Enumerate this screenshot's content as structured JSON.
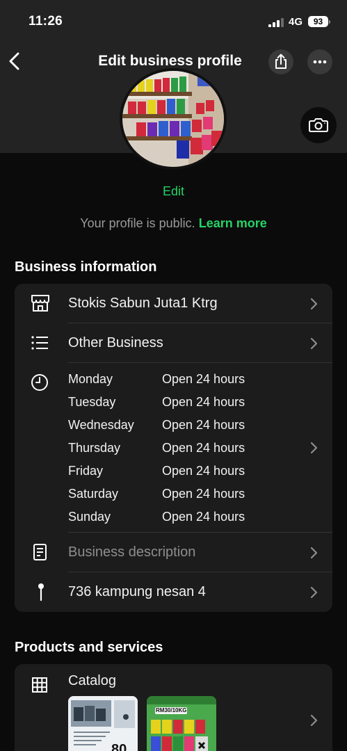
{
  "status_bar": {
    "time": "11:26",
    "network": "4G",
    "battery": "93"
  },
  "nav": {
    "title": "Edit business profile"
  },
  "profile": {
    "edit_label": "Edit",
    "public_text": "Your profile is public.",
    "learn_more": "Learn more"
  },
  "business_info": {
    "section_title": "Business information",
    "name": "Stokis Sabun Juta1 Ktrg",
    "category": "Other Business",
    "hours": [
      {
        "day": "Monday",
        "value": "Open 24 hours"
      },
      {
        "day": "Tuesday",
        "value": "Open 24 hours"
      },
      {
        "day": "Wednesday",
        "value": "Open 24 hours"
      },
      {
        "day": "Thursday",
        "value": "Open 24 hours"
      },
      {
        "day": "Friday",
        "value": "Open 24 hours"
      },
      {
        "day": "Saturday",
        "value": "Open 24 hours"
      },
      {
        "day": "Sunday",
        "value": "Open 24 hours"
      }
    ],
    "description_placeholder": "Business description",
    "address": "736 kampung nesan 4"
  },
  "products": {
    "section_title": "Products and services",
    "catalog_label": "Catalog",
    "thumb1_price": "80",
    "thumb2_label": "RM30/10KG"
  },
  "icons": {
    "back": "chevron-left-icon",
    "share": "share-icon",
    "more": "more-horizontal-icon",
    "camera": "camera-icon",
    "store": "store-icon",
    "list": "list-icon",
    "clock": "clock-icon",
    "document": "document-icon",
    "pin": "pin-icon",
    "grid": "grid-icon",
    "chevron": "chevron-right-icon"
  },
  "colors": {
    "accent": "#25d366",
    "background": "#0b0b0b",
    "card": "#1c1c1c",
    "header": "#232323"
  }
}
